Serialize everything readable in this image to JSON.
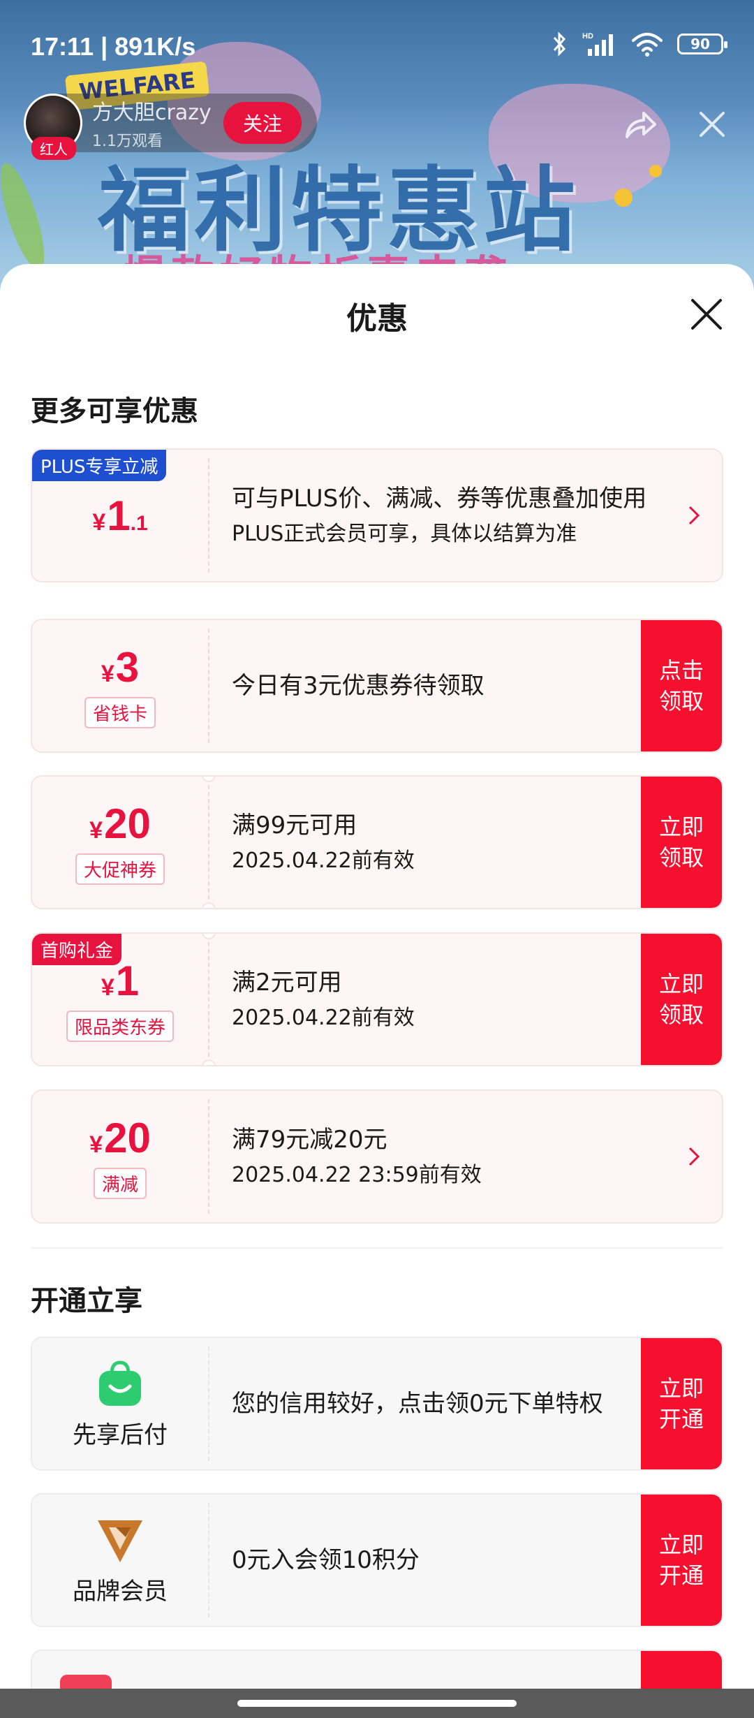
{
  "status_bar": {
    "time": "17:11 | 891K/s",
    "battery": "90"
  },
  "live": {
    "welfare_badge": "WELFARE",
    "banner_title": "福利特惠站",
    "banner_subtitle": "爆款好物折惠来袭",
    "streamer_name": "方大胆crazy",
    "streamer_views": "1.1万观看",
    "streamer_tag": "红人",
    "follow_label": "关注"
  },
  "sheet": {
    "title": "优惠",
    "section_more": "更多可享优惠",
    "section_open": "开通立享"
  },
  "coupons": [
    {
      "corner_tag": "PLUS专享立减",
      "symbol": "¥",
      "amount": "1",
      "decimal": ".1",
      "line1": "可与PLUS价、满减、券等优惠叠加使用",
      "line2": "PLUS正式会员可享，具体以结算为准"
    },
    {
      "symbol": "¥",
      "amount": "3",
      "tag": "省钱卡",
      "line1": "今日有3元优惠券待领取",
      "button": "点击领取"
    },
    {
      "symbol": "¥",
      "amount": "20",
      "tag": "大促神券",
      "line1": "满99元可用",
      "line2": "2025.04.22前有效",
      "button": "立即领取"
    },
    {
      "corner_tag": "首购礼金",
      "symbol": "¥",
      "amount": "1",
      "tag": "限品类东券",
      "line1": "满2元可用",
      "line2": "2025.04.22前有效",
      "button": "立即领取"
    },
    {
      "symbol": "¥",
      "amount": "20",
      "tag": "满减",
      "line1": "满79元减20元",
      "line2": "2025.04.22 23:59前有效"
    }
  ],
  "services": [
    {
      "icon": "green-shopping-bag-icon",
      "label": "先享后付",
      "text": "您的信用较好，点击领0元下单特权",
      "button": "立即开通"
    },
    {
      "icon": "brand-v-logo-icon",
      "label": "品牌会员",
      "text": "0元入会领10积分",
      "button": "立即开通"
    }
  ],
  "colors": {
    "accent_red": "#f5102f",
    "plus_blue": "#1f4fd1",
    "pay_green": "#2ecc71",
    "brand_gold": "#c8782a"
  }
}
